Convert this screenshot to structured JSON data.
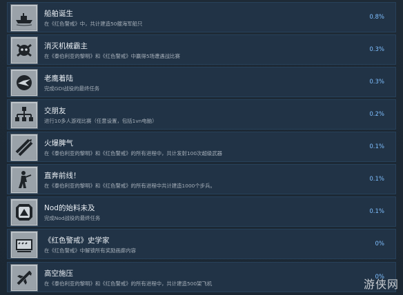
{
  "achievements": [
    {
      "title": "船舶诞生",
      "desc": "在《红色警戒》中，共计建造50艘海军船只",
      "pct": "0.8%",
      "icon": "ship-icon"
    },
    {
      "title": "消灭机械霸主",
      "desc": "在《泰伯利亚的黎明》和《红色警戒》中赢得5场遭遇战比赛",
      "pct": "0.3%",
      "icon": "mech-icon"
    },
    {
      "title": "老鹰着陆",
      "desc": "完成GDI战役的最终任务",
      "pct": "0.3%",
      "icon": "eagle-icon"
    },
    {
      "title": "交朋友",
      "desc": "进行10多人游戏比赛（任意设置，包括1vn电脑）",
      "pct": "0.2%",
      "icon": "network-icon"
    },
    {
      "title": "火爆脾气",
      "desc": "在《泰伯利亚的黎明》和《红色警戒》的所有进程中，共计发射100次超级武器",
      "pct": "0.1%",
      "icon": "missile-icon"
    },
    {
      "title": "直奔前线！",
      "desc": "在《泰伯利亚的黎明》和《红色警戒》的所有进程中共计建造1000个步兵。",
      "pct": "0.1%",
      "icon": "soldier-icon"
    },
    {
      "title": "Nod的始料未及",
      "desc": "完成Nod战役的最终任务",
      "pct": "0.1%",
      "icon": "nod-icon"
    },
    {
      "title": "《红色警戒》史学家",
      "desc": "在《红色警戒》中解锁所有奖励画廊内容",
      "pct": "0%",
      "icon": "gallery-icon"
    },
    {
      "title": "高空施压",
      "desc": "在《泰伯利亚的黎明》和《红色警戒》的所有进程中，共计建造500架飞机",
      "pct": "0%",
      "icon": "plane-icon"
    }
  ],
  "watermark": "游侠网"
}
